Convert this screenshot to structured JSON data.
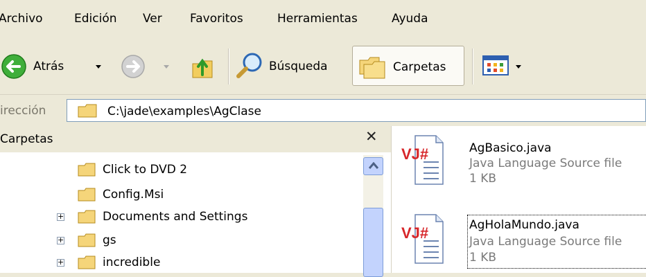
{
  "menu": [
    "Archivo",
    "Edición",
    "Ver",
    "Favoritos",
    "Herramientas",
    "Ayuda"
  ],
  "toolbar": {
    "back_label": "Atrás",
    "search_label": "Búsqueda",
    "folders_label": "Carpetas"
  },
  "address": {
    "label": "irección",
    "path": "C:\\jade\\examples\\AgClase"
  },
  "folders_pane": {
    "title": "Carpetas",
    "items": [
      {
        "label": "Click to DVD 2",
        "expander": ""
      },
      {
        "label": "Config.Msi",
        "expander": ""
      },
      {
        "label": "Documents and Settings",
        "expander": "+"
      },
      {
        "label": "gs",
        "expander": "+"
      },
      {
        "label": "incredible",
        "expander": "+"
      }
    ]
  },
  "files": [
    {
      "name": "AgBasico.java",
      "type": "Java Language Source file",
      "size": "1 KB",
      "icon_text": "VJ#"
    },
    {
      "name": "AgHolaMundo.java",
      "type": "Java Language Source file",
      "size": "1 KB",
      "icon_text": "VJ#"
    }
  ],
  "colors": {
    "chrome": "#ece9d8",
    "folder": "#f5d57a",
    "accent_blue": "#7f9db9",
    "vj_red": "#d7262a"
  }
}
